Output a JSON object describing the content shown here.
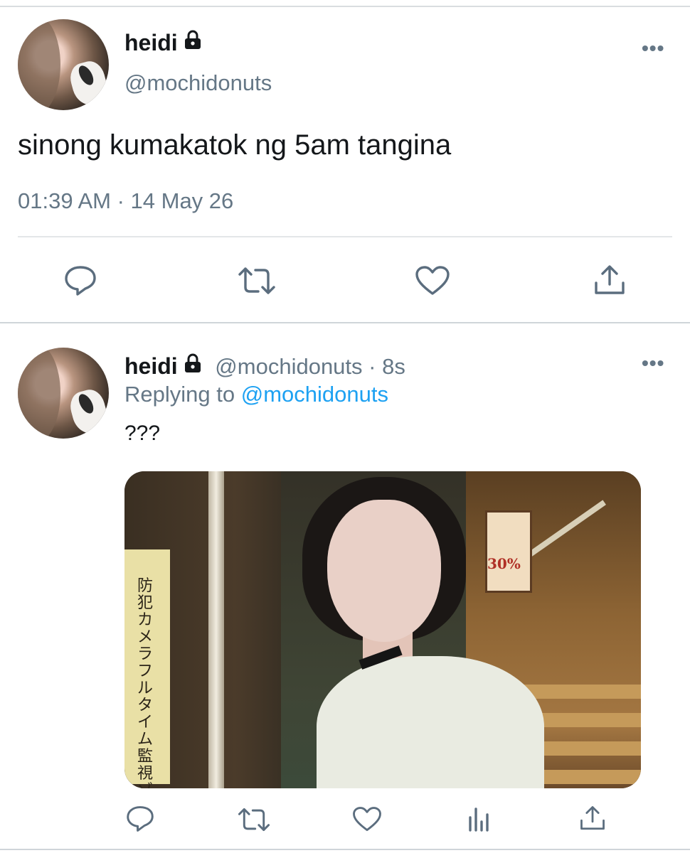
{
  "tweet_main": {
    "display_name": "heidi",
    "handle": "@mochidonuts",
    "text": "sinong kumakatok ng 5am tangina",
    "timestamp": "01:39 AM · 14 May 26",
    "more_label": "•••"
  },
  "tweet_reply": {
    "display_name": "heidi",
    "handle": "@mochidonuts",
    "time_ago": "8s",
    "replying_prefix": "Replying to",
    "replying_to": "@mochidonuts",
    "text": "???",
    "more_label": "•••"
  },
  "photo_sign_text": "防犯カメラフルタイム監視ゾーン",
  "photo_menu_text": "30%",
  "colors": {
    "link": "#1da1f2",
    "secondary": "#657786",
    "primary_text": "#14171a",
    "icon": "#5b6d7e"
  },
  "icons": [
    "lock-icon",
    "more-icon",
    "reply-icon",
    "retweet-icon",
    "like-icon",
    "share-icon",
    "analytics-icon"
  ]
}
